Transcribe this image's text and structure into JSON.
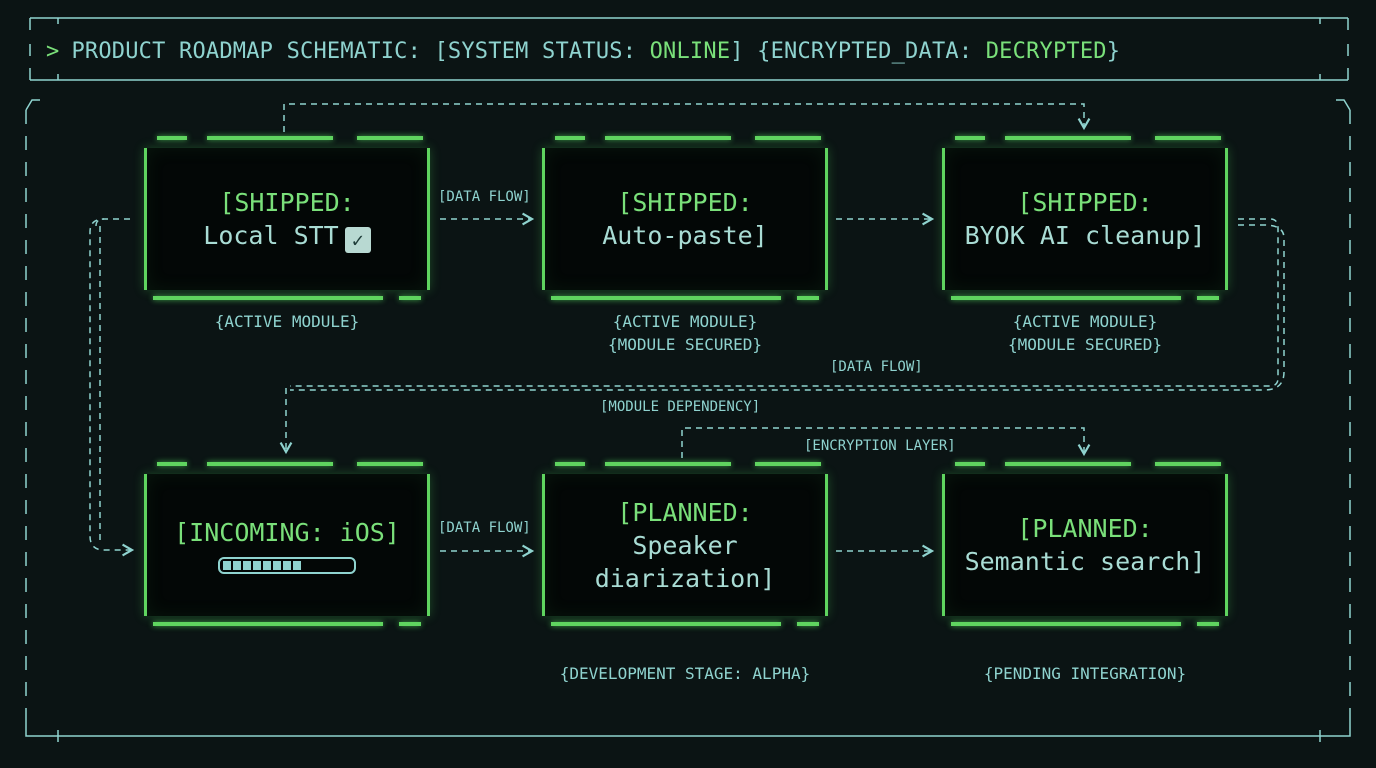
{
  "header": {
    "prompt": ">",
    "prefix": "PRODUCT ROADMAP SCHEMATIC: [SYSTEM STATUS: ",
    "status": "ONLINE",
    "mid": "] {ENCRYPTED_DATA: ",
    "encrypted_state": "DECRYPTED",
    "suffix": "}"
  },
  "nodes": {
    "local_stt": {
      "title": "[SHIPPED:",
      "body": "Local STT",
      "icon": "checkmark-icon",
      "icon_glyph": "✓",
      "caption1": "{ACTIVE MODULE}"
    },
    "auto_paste": {
      "title": "[SHIPPED:",
      "body": "Auto-paste]",
      "caption1": "{ACTIVE MODULE}",
      "caption2": "{MODULE SECURED}"
    },
    "byok": {
      "title": "[SHIPPED:",
      "body": "BYOK AI cleanup]",
      "caption1": "{ACTIVE MODULE}",
      "caption2": "{MODULE SECURED}"
    },
    "ios": {
      "title": "[INCOMING: iOS]",
      "progress_fraction": 0.6,
      "caption1": ""
    },
    "speaker": {
      "title": "[PLANNED:",
      "body1": "Speaker",
      "body2": "diarization]",
      "caption1": "{DEVELOPMENT STAGE: ALPHA}"
    },
    "semantic": {
      "title": "[PLANNED:",
      "body": "Semantic search]",
      "caption1": "{PENDING INTEGRATION}"
    }
  },
  "flow_labels": {
    "data_flow_1": "[DATA FLOW]",
    "data_flow_2": "[DATA FLOW]",
    "data_flow_3": "[DATA FLOW]",
    "module_dependency": "[MODULE DEPENDENCY]",
    "encryption_layer": "[ENCRYPTION LAYER]"
  },
  "colors": {
    "background": "#0b1414",
    "frame": "#8fd3cf",
    "accent_green": "#7ae07a",
    "node_border": "#5fd45f"
  }
}
